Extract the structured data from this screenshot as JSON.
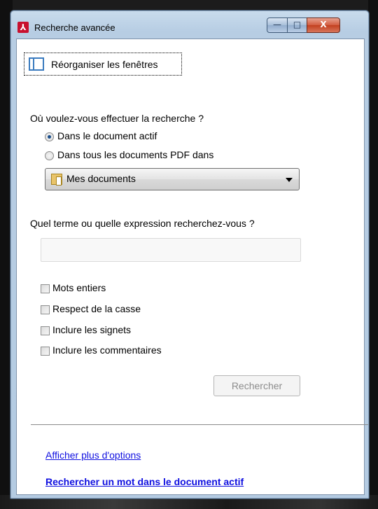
{
  "window": {
    "title": "Recherche avancée",
    "app_icon": "acrobat-icon",
    "controls": {
      "minimize": "—",
      "maximize": "□",
      "close": "X"
    }
  },
  "toolbar": {
    "reorganize_label": "Réorganiser les fenêtres",
    "reorganize_icon": "window-panes-icon"
  },
  "search_location": {
    "question": "Où voulez-vous effectuer la recherche ?",
    "options": [
      {
        "label": "Dans le document actif",
        "checked": true
      },
      {
        "label": "Dans tous les documents PDF dans",
        "checked": false
      }
    ],
    "folder": {
      "value": "Mes documents",
      "icon": "folder-icon"
    }
  },
  "search_term": {
    "question": "Quel terme ou quelle expression recherchez-vous ?",
    "value": "",
    "placeholder": ""
  },
  "options": [
    {
      "label": "Mots entiers",
      "checked": false
    },
    {
      "label": "Respect de la casse",
      "checked": false
    },
    {
      "label": "Inclure les signets",
      "checked": false
    },
    {
      "label": "Inclure les commentaires",
      "checked": false
    }
  ],
  "actions": {
    "search_button": "Rechercher",
    "search_button_enabled": false
  },
  "links": {
    "more_options": "Afficher plus d'options",
    "search_word": "Rechercher un mot dans le document actif"
  },
  "colors": {
    "link": "#1010e0",
    "title_bar": "#b7cde3",
    "close_button": "#c2401f"
  }
}
